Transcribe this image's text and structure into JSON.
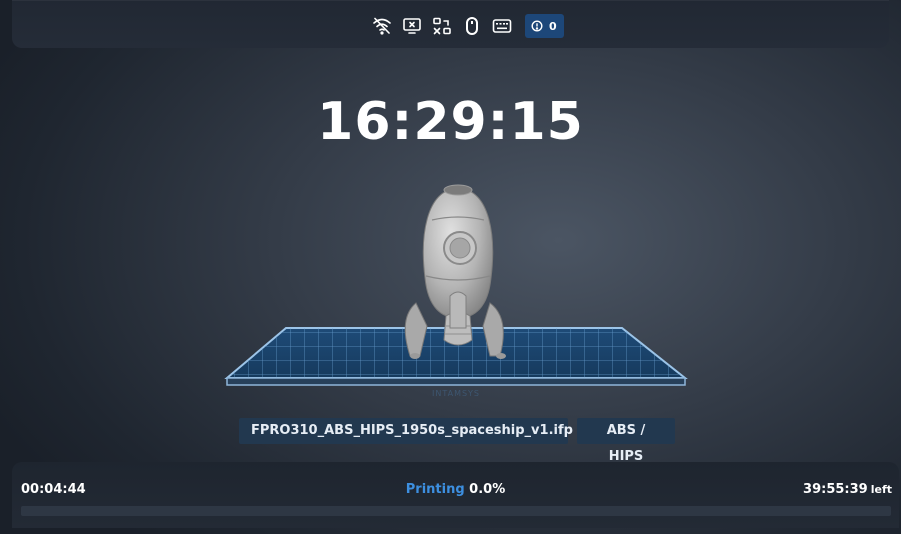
{
  "status_bar": {
    "icons": [
      "wifi-off-icon",
      "screen-off-icon",
      "network-disconnected-icon",
      "mouse-icon",
      "keyboard-icon"
    ],
    "error_icon": "alert-circle-icon",
    "error_count": "0"
  },
  "clock": {
    "time": "16:29:15"
  },
  "preview": {
    "platform_brand": "INTAMSYS"
  },
  "job": {
    "file_name": "FPRO310_ABS_HIPS_1950s_spaceship_v1.ifp",
    "material": "ABS / HIPS"
  },
  "progress": {
    "elapsed": "00:04:44",
    "state": "Printing",
    "percent_text": "0.0%",
    "percent": 0.0,
    "remaining": "39:55:39",
    "remaining_suffix": "left"
  },
  "colors": {
    "accent": "#3d8fe0",
    "chip_bg": "#22384f",
    "badge_bg": "#1d4779"
  }
}
